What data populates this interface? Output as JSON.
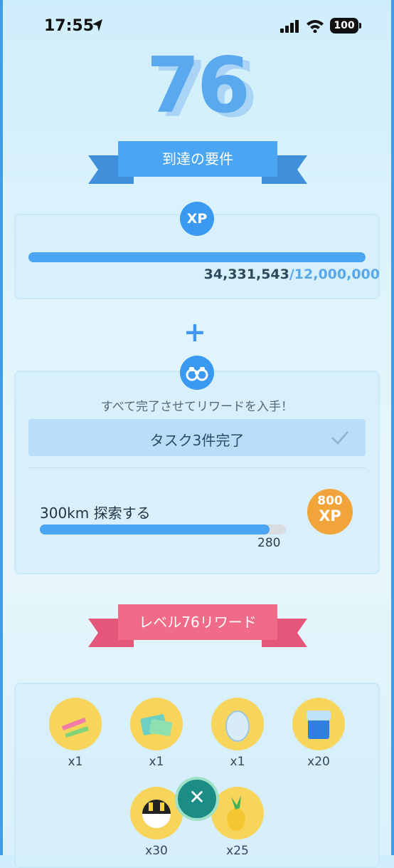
{
  "status_bar": {
    "time": "17:55",
    "battery": "100"
  },
  "level": "76",
  "requirements_title": "到達の要件",
  "xp": {
    "badge": "XP",
    "current": "34,331,543",
    "goal": "/12,000,000",
    "progress": 1.0
  },
  "plus": "+",
  "tasks": {
    "subtitle": "すべて完了させてリワードを入手！",
    "complete_label": "タスク3件完了",
    "quest": {
      "label": "300km 探索する",
      "value": "280",
      "progress": 0.933,
      "reward_amount": "800",
      "reward_unit": "XP"
    }
  },
  "rewards_title": "レベル76リワード",
  "rewards": [
    {
      "icon": "rainbow-candy-icon",
      "count": "x1"
    },
    {
      "icon": "tm-ticket-icon",
      "count": "x1"
    },
    {
      "icon": "egg-icon",
      "count": "x1"
    },
    {
      "icon": "box-icon",
      "count": "x20"
    },
    {
      "icon": "ultra-ball-icon",
      "count": "x30"
    },
    {
      "icon": "pinap-berry-icon",
      "count": "x25"
    }
  ],
  "colors": {
    "accent": "#4aa5f2",
    "pink": "#f06b87",
    "gold": "#f7d45a",
    "orange": "#f0a43a"
  }
}
